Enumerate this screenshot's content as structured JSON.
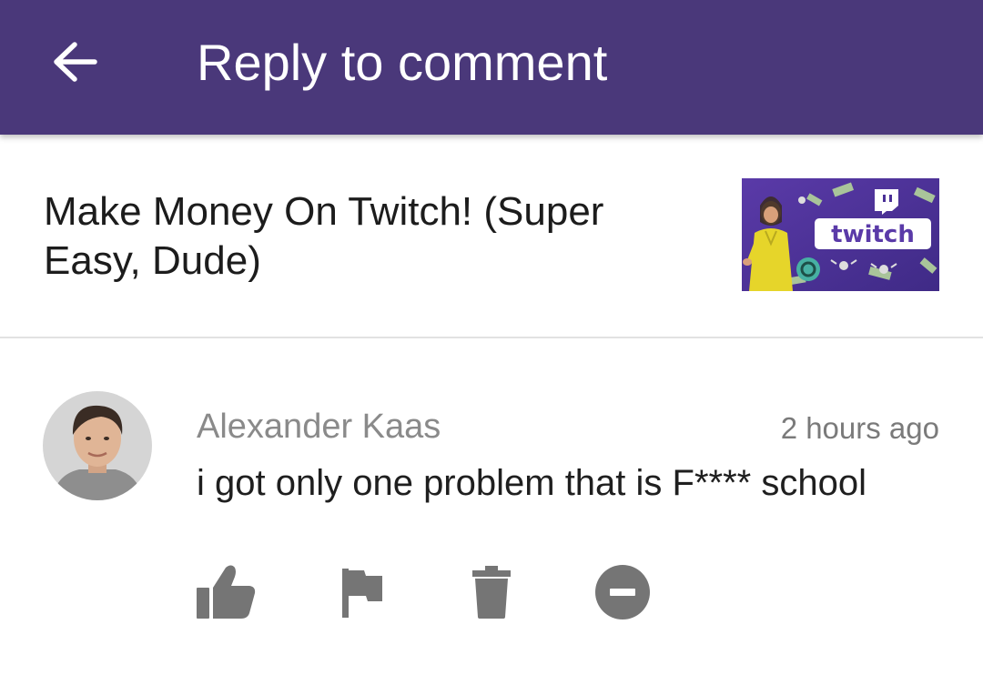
{
  "app_bar": {
    "title": "Reply to comment",
    "back_icon": "arrow-left-icon",
    "background": "#4a387a"
  },
  "video": {
    "title": "Make Money On Twitch! (Super Easy, Dude)",
    "thumbnail": {
      "logo_text": "twitch",
      "icon": "video-thumbnail"
    }
  },
  "comment": {
    "author": "Alexander Kaas",
    "time": "2 hours ago",
    "text": "i got only one problem that is F**** school",
    "actions": [
      {
        "name": "like",
        "icon": "thumbs-up-icon"
      },
      {
        "name": "report",
        "icon": "flag-icon"
      },
      {
        "name": "delete",
        "icon": "trash-icon"
      },
      {
        "name": "block",
        "icon": "minus-circle-icon"
      }
    ]
  }
}
